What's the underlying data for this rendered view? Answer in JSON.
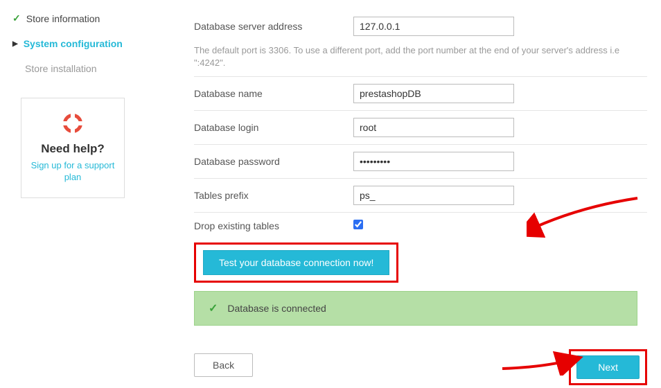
{
  "sidebar": {
    "items": [
      {
        "label": "Store information",
        "state": "done"
      },
      {
        "label": "System configuration",
        "state": "current"
      },
      {
        "label": "Store installation",
        "state": "pending"
      }
    ],
    "help": {
      "title": "Need help?",
      "link_text": "Sign up for a support plan"
    }
  },
  "form": {
    "db_address": {
      "label": "Database server address",
      "value": "127.0.0.1"
    },
    "db_address_hint": "The default port is 3306. To use a different port, add the port number at the end of your server's address i.e \":4242\".",
    "db_name": {
      "label": "Database name",
      "value": "prestashopDB"
    },
    "db_login": {
      "label": "Database login",
      "value": "root"
    },
    "db_password": {
      "label": "Database password",
      "value": "•••••••••"
    },
    "tables_prefix": {
      "label": "Tables prefix",
      "value": "ps_"
    },
    "drop_tables": {
      "label": "Drop existing tables",
      "checked": true
    }
  },
  "buttons": {
    "test": "Test your database connection now!",
    "back": "Back",
    "next": "Next"
  },
  "status": {
    "success_text": "Database is connected"
  }
}
